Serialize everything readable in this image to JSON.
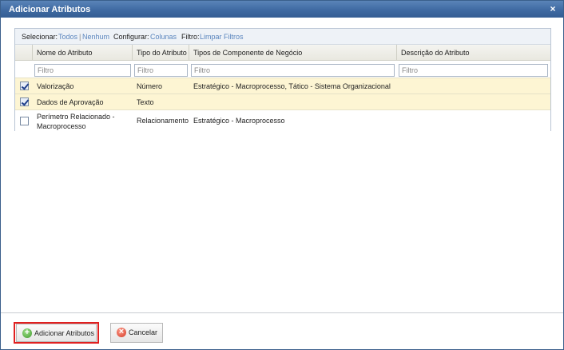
{
  "dialog": {
    "title": "Adicionar Atributos",
    "close_glyph": "×"
  },
  "toolbar": {
    "select_label": "Selecionar:",
    "select_all": "Todos",
    "separator": "|",
    "select_none": "Nenhum",
    "config_label": "Configurar:",
    "columns_link": "Colunas",
    "filter_label": "Filtro:",
    "clear_filters": "Limpar Filtros"
  },
  "columns": [
    {
      "label": "Nome do Atributo"
    },
    {
      "label": "Tipo do Atributo"
    },
    {
      "label": "Tipos de Componente de Negócio"
    },
    {
      "label": "Descrição do Atributo"
    }
  ],
  "filter_placeholder": "Filtro",
  "rows": [
    {
      "checked": true,
      "name": "Valorização",
      "type": "Número",
      "components": "Estratégico - Macroprocesso, Tático - Sistema Organizacional",
      "description": ""
    },
    {
      "checked": true,
      "name": "Dados de Aprovação",
      "type": "Texto",
      "components": "",
      "description": ""
    },
    {
      "checked": false,
      "name": "Perímetro Relacionado - Macroprocesso",
      "type": "Relacionamento",
      "components": "Estratégico - Macroprocesso",
      "description": ""
    }
  ],
  "buttons": {
    "add": "Adicionar Atributos",
    "cancel": "Cancelar"
  },
  "colors": {
    "titlebar": "#3f6aa2",
    "link": "#5b86be",
    "selected_row": "#fdf5d3",
    "focus_border": "#e02020"
  }
}
